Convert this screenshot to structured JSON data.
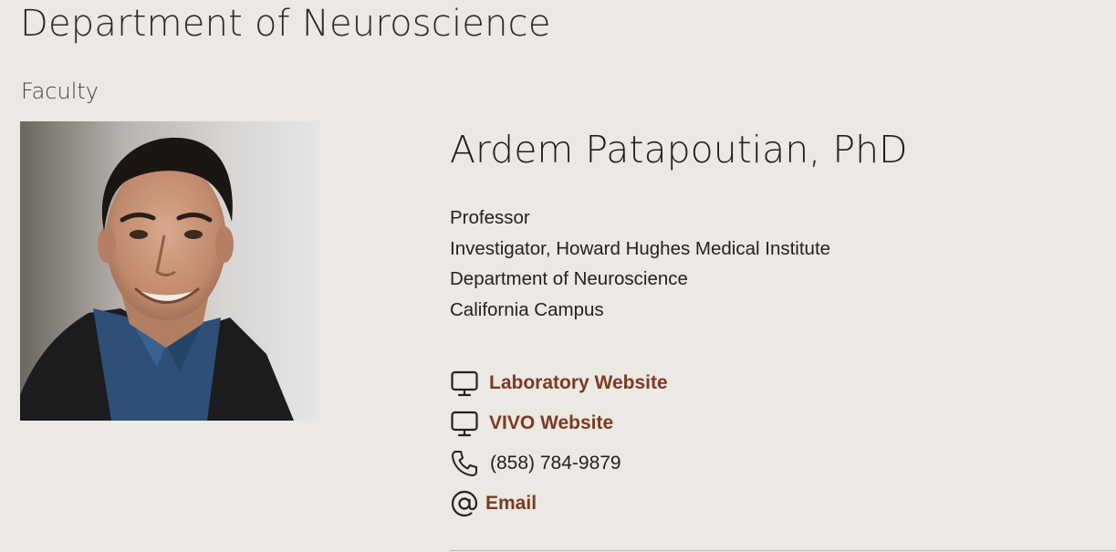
{
  "page": {
    "department_title": "Department of Neuroscience",
    "section_label": "Faculty"
  },
  "profile": {
    "name": "Ardem Patapoutian, PhD",
    "titles": [
      "Professor",
      "Investigator, Howard Hughes Medical Institute",
      "Department of Neuroscience",
      "California Campus"
    ],
    "contacts": {
      "lab_website": {
        "label": "Laboratory Website",
        "icon": "monitor-icon"
      },
      "vivo_website": {
        "label": "VIVO Website",
        "icon": "monitor-icon"
      },
      "phone": {
        "value": "(858) 784-9879",
        "icon": "phone-icon"
      },
      "email": {
        "label": "Email",
        "icon": "at-sign-icon"
      }
    }
  },
  "colors": {
    "background": "#ece8e4",
    "link": "#7a3b22",
    "text": "#222222"
  }
}
